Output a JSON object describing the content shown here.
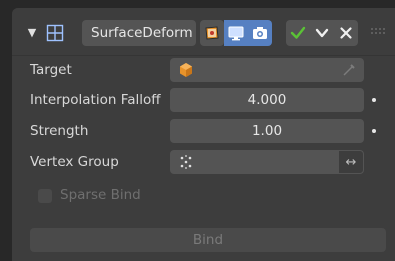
{
  "header": {
    "modifier_name": "SurfaceDeform",
    "icons": [
      "expand-arrow-icon",
      "surface-deform-modifier-icon",
      "edit-cage-icon",
      "realtime-display-icon",
      "render-icon",
      "apply-check-icon",
      "dropdown-chevron-icon",
      "close-x-icon",
      "drag-grip-icon"
    ]
  },
  "fields": {
    "target_label": "Target",
    "target_value": "",
    "falloff_label": "Interpolation Falloff",
    "falloff_value": "4.000",
    "strength_label": "Strength",
    "strength_value": "1.00",
    "vertex_group_label": "Vertex Group",
    "vertex_group_value": "",
    "vertex_group_swap": "↔",
    "sparse_bind_label": "Sparse Bind",
    "sparse_bind_checked": false,
    "sparse_bind_enabled": false
  },
  "actions": {
    "bind_label": "Bind",
    "bind_enabled": false
  },
  "colors": {
    "active_toggle": "#5680c2",
    "check_green": "#5bc236",
    "target_object_orange": "#e8932a"
  }
}
